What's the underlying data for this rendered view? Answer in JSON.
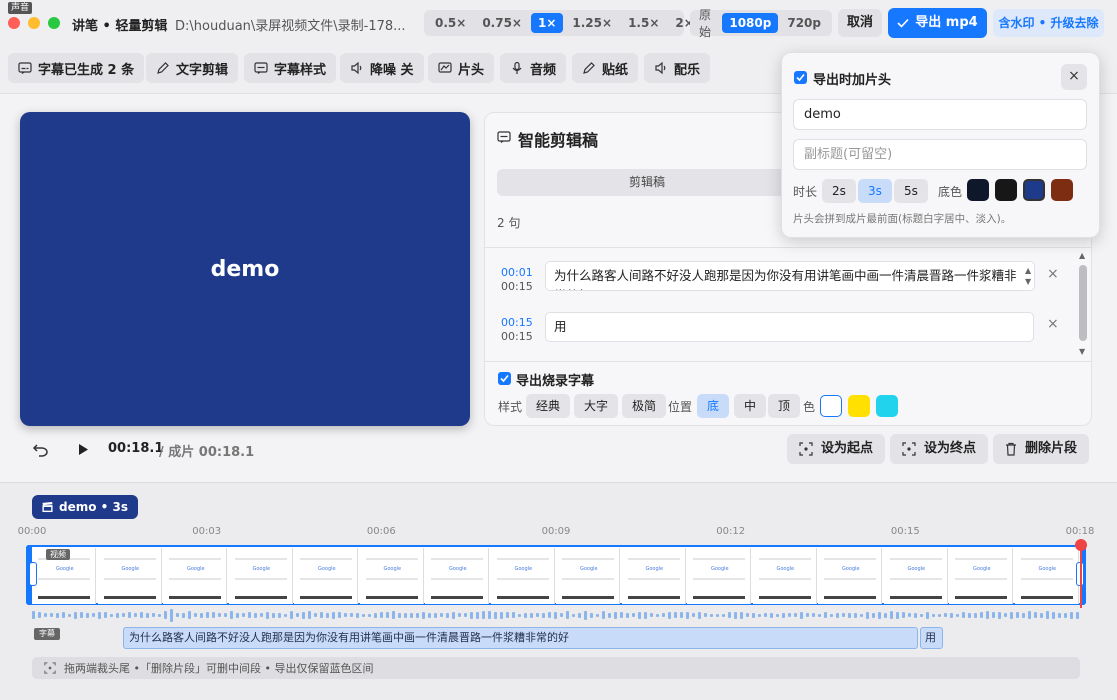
{
  "titlebar": {
    "badge": "声音",
    "title": "讲笔 • 轻量剪辑",
    "path": "D:\\houduan\\录屏视频文件\\录制-178...",
    "speeds": [
      "0.5×",
      "0.75×",
      "1×",
      "1.25×",
      "1.5×",
      "2×"
    ],
    "speed_selected": "1×",
    "res_label": "原始",
    "resolutions": [
      "1080p",
      "720p"
    ],
    "res_selected": "1080p",
    "cancel": "取消",
    "export": "导出 mp4",
    "upgrade": "含水印 • 升级去除",
    "colors": {
      "close": "#ff5f57",
      "min": "#febc2e",
      "max": "#28c840",
      "accent": "#1677ff"
    }
  },
  "toolbar": {
    "items": [
      {
        "label": "字幕已生成 2 条",
        "icon": "subtitle-icon"
      },
      {
        "label": "文字剪辑",
        "icon": "pencil-icon"
      },
      {
        "label": "字幕样式",
        "icon": "subtitle-style-icon"
      },
      {
        "label": "降噪 关",
        "icon": "speaker-icon"
      },
      {
        "label": "片头",
        "icon": "intro-icon"
      },
      {
        "label": "音频",
        "icon": "mic-icon"
      },
      {
        "label": "贴纸",
        "icon": "pencil-icon"
      },
      {
        "label": "配乐",
        "icon": "speaker-icon"
      }
    ]
  },
  "video": {
    "text": "demo",
    "bg": "#1f3a8a"
  },
  "panel": {
    "title": "智能剪辑稿",
    "tab": "剪辑稿",
    "count": "2 句",
    "rows": [
      {
        "start": "00:01",
        "end": "00:15",
        "text": "为什么路客人间路不好没人跑那是因为你没有用讲笔画中画一件清晨晋路一件浆糟非常的好"
      },
      {
        "start": "00:15",
        "end": "00:15",
        "text": "用"
      }
    ],
    "burn_label": "导出烧录字幕",
    "style_label": "样式",
    "styles": [
      "经典",
      "大字",
      "极简"
    ],
    "pos_label": "位置",
    "positions": [
      "底",
      "中",
      "顶"
    ],
    "pos_selected": "底",
    "color_label": "色",
    "colors": [
      "#ffffff",
      "#ffe000",
      "#22d3ee"
    ]
  },
  "popup": {
    "title": "导出时加片头",
    "title_value": "demo",
    "subtitle_placeholder": "副标题(可留空)",
    "duration_label": "时长",
    "durations": [
      "2s",
      "3s",
      "5s"
    ],
    "duration_selected": "3s",
    "bg_label": "底色",
    "bg_colors": [
      "#0f172a",
      "#171717",
      "#1e3a8a",
      "#7c2d12"
    ],
    "note": "片头会拼到成片最前面(标题白字居中、淡入)。"
  },
  "player": {
    "time": "00:18.1",
    "total": "/ 成片 00:18.1",
    "set_start": "设为起点",
    "set_end": "设为终点",
    "delete": "删除片段"
  },
  "timeline": {
    "clip_label": "demo • 3s",
    "ticks": [
      "00:00",
      "00:03",
      "00:06",
      "00:09",
      "00:12",
      "00:15",
      "00:18"
    ],
    "video_tag": "视频",
    "caption_tag": "字幕",
    "captions": [
      "为什么路客人间路不好没人跑那是因为你没有用讲笔画中画一件清晨晋路一件浆糟非常的好",
      "用"
    ],
    "hint": "拖两端裁头尾 •「删除片段」可删中间段 • 导出仅保留蓝色区间"
  }
}
